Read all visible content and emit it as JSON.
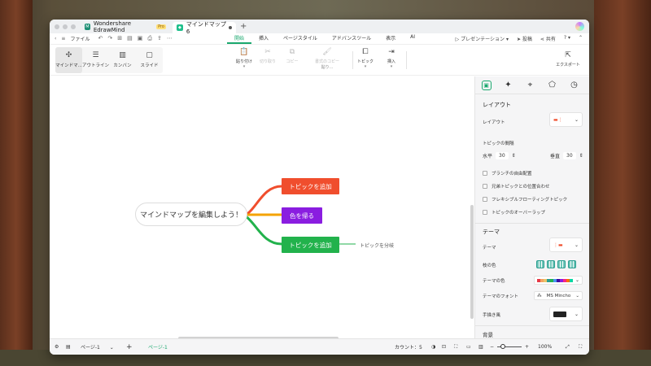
{
  "colors": {
    "accent": "#1aa86e",
    "topic_red": "#f04e2d",
    "topic_purple": "#8a1de0",
    "topic_green": "#22b24c",
    "branch_orange": "#f4a300"
  },
  "tabs": {
    "app": {
      "name": "Wondershare EdrawMind",
      "badge": "Pro"
    },
    "doc": {
      "name": "マインドマップ6"
    }
  },
  "menubar": {
    "file": "ファイル",
    "items": [
      "開始",
      "挿入",
      "ページスタイル",
      "アドバンスツール",
      "表示",
      "AI"
    ],
    "presentation": "プレゼンテーション",
    "publish": "投稿",
    "share": "共有"
  },
  "ribbon": {
    "views": [
      "マインドマ...",
      "アウトライン",
      "カンバン",
      "スライド"
    ],
    "paste": "貼り付け",
    "cut": "切り取り",
    "copy": "コピー",
    "format_copy": "書式のコピー",
    "format_copy_sub": "貼り...",
    "topic": "トピック",
    "insert": "挿入",
    "export": "エクスポート"
  },
  "map": {
    "root": "マインドマップを編集しよう！",
    "topics": [
      "トピックを追加",
      "色を帰る",
      "トピックを追加"
    ],
    "subtopic": "トピックを分岐"
  },
  "panel": {
    "layout_title": "レイアウト",
    "layout_label": "レイアウト",
    "spacing_label": "トピックの間隔",
    "horizontal": "水平",
    "horizontal_value": "30",
    "vertical": "垂直",
    "vertical_value": "30",
    "checks": [
      "ブランチの自由配置",
      "兄弟トピックとの位置合わせ",
      "フレキシブルフローティングトピック",
      "トピックのオーバーラップ"
    ],
    "theme_title": "テーマ",
    "theme_label": "テーマ",
    "branch_color": "枝の色",
    "theme_color": "テーマの色",
    "theme_font": "テーマのフォント",
    "font_value": "MS Mincho",
    "hand_drawn": "手描き風",
    "background": "背景"
  },
  "status": {
    "page_select": "ページ-1",
    "page_tab": "ページ-1",
    "count_label": "カウント：",
    "count_value": "5",
    "zoom": "100%"
  }
}
